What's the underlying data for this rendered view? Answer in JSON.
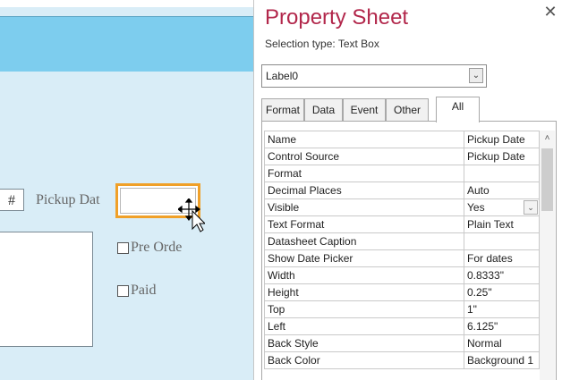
{
  "form": {
    "hash_label": "#",
    "pickup_label": "Pickup Dat",
    "checkboxes": [
      {
        "label": "Pre Orde"
      },
      {
        "label": "Paid"
      }
    ]
  },
  "property_sheet": {
    "title": "Property Sheet",
    "close_symbol": "✕",
    "selection_type": "Selection type:  Text Box",
    "selected_object": "Label0",
    "tabs": [
      {
        "label": "Format",
        "active": false
      },
      {
        "label": "Data",
        "active": false
      },
      {
        "label": "Event",
        "active": false
      },
      {
        "label": "Other",
        "active": false
      },
      {
        "label": "All",
        "active": true
      }
    ],
    "properties": [
      {
        "name": "Name",
        "value": "Pickup Date"
      },
      {
        "name": "Control Source",
        "value": "Pickup Date"
      },
      {
        "name": "Format",
        "value": ""
      },
      {
        "name": "Decimal Places",
        "value": "Auto"
      },
      {
        "name": "Visible",
        "value": "Yes"
      },
      {
        "name": "Text Format",
        "value": "Plain Text"
      },
      {
        "name": "Datasheet Caption",
        "value": ""
      },
      {
        "name": "Show Date Picker",
        "value": "For dates"
      },
      {
        "name": "Width",
        "value": "0.8333\""
      },
      {
        "name": "Height",
        "value": "0.25\""
      },
      {
        "name": "Top",
        "value": "1\""
      },
      {
        "name": "Left",
        "value": "6.125\""
      },
      {
        "name": "Back Style",
        "value": "Normal"
      },
      {
        "name": "Back Color",
        "value": "Background 1"
      }
    ]
  },
  "colors": {
    "title": "#b2274b",
    "form_header": "#7dcdee",
    "form_body": "#d9edf7",
    "selection_border": "#f0a028"
  },
  "icons": {
    "combo_dropdown": "chevron-down-icon",
    "cursor": "move-cursor-icon",
    "scroll_up": "chevron-up-icon"
  }
}
